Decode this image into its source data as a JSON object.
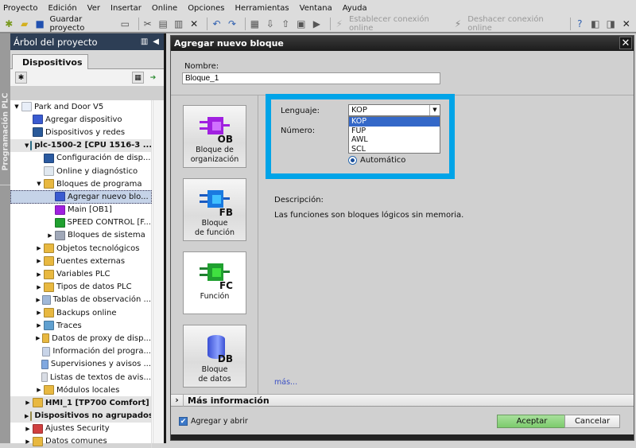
{
  "menu": [
    "Proyecto",
    "Edición",
    "Ver",
    "Insertar",
    "Online",
    "Opciones",
    "Herramientas",
    "Ventana",
    "Ayuda"
  ],
  "toolbar": {
    "save_label": "Guardar proyecto",
    "go_online": "Establecer conexión online",
    "go_offline": "Deshacer conexión online"
  },
  "side_tab": "Programación PLC",
  "tree": {
    "title": "Árbol del proyecto",
    "tab": "Dispositivos",
    "items": [
      {
        "label": "Park and Door V5",
        "level": 0,
        "expand": "open",
        "icon": "#e8eef8"
      },
      {
        "label": "Agregar dispositivo",
        "level": 1,
        "expand": "",
        "icon": "#3a5bd0"
      },
      {
        "label": "Dispositivos y redes",
        "level": 1,
        "expand": "",
        "icon": "#2a5a9a"
      },
      {
        "label": "plc-1500-2 [CPU 1516-3 ...",
        "level": 1,
        "expand": "open",
        "icon": "#3a8fb0",
        "bold": true,
        "gray": true
      },
      {
        "label": "Configuración de disp...",
        "level": 2,
        "expand": "",
        "icon": "#2a5aa0"
      },
      {
        "label": "Online y diagnóstico",
        "level": 2,
        "expand": "",
        "icon": "#e0e8f0"
      },
      {
        "label": "Bloques de programa",
        "level": 2,
        "expand": "open",
        "icon": "#e8b840"
      },
      {
        "label": "Agregar nuevo blo...",
        "level": 3,
        "expand": "",
        "icon": "#3a5bd0",
        "selected": true
      },
      {
        "label": "Main [OB1]",
        "level": 3,
        "expand": "",
        "icon": "#a020e0"
      },
      {
        "label": "SPEED CONTROL [F...",
        "level": 3,
        "expand": "",
        "icon": "#20a030"
      },
      {
        "label": "Bloques de sistema",
        "level": 3,
        "expand": "closed",
        "icon": "#a0a8b8"
      },
      {
        "label": "Objetos tecnológicos",
        "level": 2,
        "expand": "closed",
        "icon": "#e8b840"
      },
      {
        "label": "Fuentes externas",
        "level": 2,
        "expand": "closed",
        "icon": "#e8b840"
      },
      {
        "label": "Variables PLC",
        "level": 2,
        "expand": "closed",
        "icon": "#e8b840"
      },
      {
        "label": "Tipos de datos PLC",
        "level": 2,
        "expand": "closed",
        "icon": "#e8b840"
      },
      {
        "label": "Tablas de observación ...",
        "level": 2,
        "expand": "closed",
        "icon": "#a0b8d8"
      },
      {
        "label": "Backups online",
        "level": 2,
        "expand": "closed",
        "icon": "#e8b840"
      },
      {
        "label": "Traces",
        "level": 2,
        "expand": "closed",
        "icon": "#60a0d0"
      },
      {
        "label": "Datos de proxy de disp...",
        "level": 2,
        "expand": "closed",
        "icon": "#e8b840"
      },
      {
        "label": "Información del progra...",
        "level": 2,
        "expand": "",
        "icon": "#c8d4e8"
      },
      {
        "label": "Supervisiones y avisos ...",
        "level": 2,
        "expand": "",
        "icon": "#80a8e0"
      },
      {
        "label": "Listas de textos de avis...",
        "level": 2,
        "expand": "",
        "icon": "#d8dce4"
      },
      {
        "label": "Módulos locales",
        "level": 2,
        "expand": "closed",
        "icon": "#e8b840"
      },
      {
        "label": "HMI_1 [TP700 Comfort]",
        "level": 1,
        "expand": "closed",
        "icon": "#e8b840",
        "bold": true,
        "gray": true
      },
      {
        "label": "Dispositivos no agrupados",
        "level": 1,
        "expand": "closed",
        "icon": "#c8b860",
        "bold": true,
        "gray": true
      },
      {
        "label": "Ajustes Security",
        "level": 1,
        "expand": "closed",
        "icon": "#d04040"
      },
      {
        "label": "Datos comunes",
        "level": 1,
        "expand": "closed",
        "icon": "#e8b840"
      }
    ]
  },
  "dialog": {
    "title": "Agregar nuevo bloque",
    "name_label": "Nombre:",
    "name_value": "Bloque_1",
    "blocks": [
      {
        "code": "OB",
        "label1": "Bloque de",
        "label2": "organización",
        "color": "#a020e0",
        "inner": "#d070ff"
      },
      {
        "code": "FB",
        "label1": "Bloque",
        "label2": "de función",
        "color": "#1a7ae0",
        "inner": "#40c0ff"
      },
      {
        "code": "FC",
        "label1": "Función",
        "label2": "",
        "color": "#20a030",
        "inner": "#40e040"
      },
      {
        "code": "DB",
        "label1": "Bloque",
        "label2": "de datos",
        "color": "#3a4fd4",
        "inner": "#8aa0ff"
      }
    ],
    "language_label": "Lenguaje:",
    "language_value": "KOP",
    "language_options": [
      "KOP",
      "FUP",
      "AWL",
      "SCL"
    ],
    "number_label": "Número:",
    "auto_label": "Automático",
    "description_label": "Descripción:",
    "description_text": "Las funciones son bloques lógicos sin memoria.",
    "more_link": "más...",
    "more_info": "Más información",
    "add_open_label": "Agregar y abrir",
    "ok_label": "Aceptar",
    "cancel_label": "Cancelar",
    "highlight_color": "#00a4e8"
  }
}
